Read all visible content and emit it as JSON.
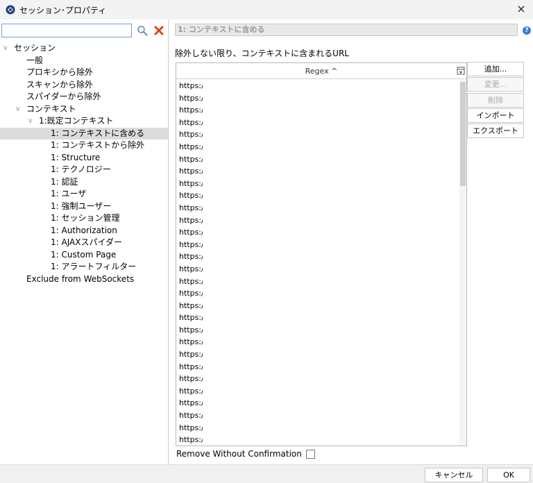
{
  "window": {
    "title": "セッション･プロパティ",
    "close_symbol": "×"
  },
  "search": {
    "value": "",
    "placeholder": ""
  },
  "tree": {
    "items": [
      {
        "label": "セッション",
        "caret": "∨"
      },
      {
        "label": "一般"
      },
      {
        "label": "プロキシから除外"
      },
      {
        "label": "スキャンから除外"
      },
      {
        "label": "スパイダーから除外"
      },
      {
        "label": "コンテキスト",
        "caret": "∨"
      },
      {
        "label": "1:既定コンテキスト",
        "caret": "∨"
      },
      {
        "label": "1: コンテキストに含める",
        "selected": true
      },
      {
        "label": "1: コンテキストから除外"
      },
      {
        "label": "1: Structure"
      },
      {
        "label": "1: テクノロジー"
      },
      {
        "label": "1: 認証"
      },
      {
        "label": "1: ユーザ"
      },
      {
        "label": "1: 強制ユーザー"
      },
      {
        "label": "1: セッション管理"
      },
      {
        "label": "1: Authorization"
      },
      {
        "label": "1: AJAXスパイダー"
      },
      {
        "label": "1: Custom Page"
      },
      {
        "label": "1: アラートフィルター"
      },
      {
        "label": "Exclude from WebSockets"
      }
    ]
  },
  "panel": {
    "header_title": "1: コンテキストに含める",
    "help_symbol": "?",
    "section_label": "除外しない限り、コンテキストに含まれるURL",
    "table": {
      "column_header": "Regex ^",
      "rows": [
        "https://",
        "https://",
        "https://",
        "https://",
        "https://",
        "https://",
        "https://",
        "https://",
        "https://",
        "https://",
        "https://",
        "https://",
        "https://",
        "https://",
        "https://",
        "https://",
        "https://",
        "https://",
        "https://",
        "https://",
        "https://",
        "https://",
        "https://",
        "https://",
        "https://",
        "https://",
        "https://",
        "https://",
        "https://",
        "https://"
      ]
    },
    "buttons": {
      "add": "追加...",
      "modify": "変更...",
      "remove": "削除",
      "import": "インポート",
      "export": "エクスポート"
    },
    "remove_without_confirmation": "Remove Without Confirmation"
  },
  "footer": {
    "cancel": "キャンセル",
    "ok": "OK"
  },
  "colors": {
    "accent": "#3b7ddd",
    "selection": "#dcdcdc",
    "delete_icon": "#e0401c"
  }
}
